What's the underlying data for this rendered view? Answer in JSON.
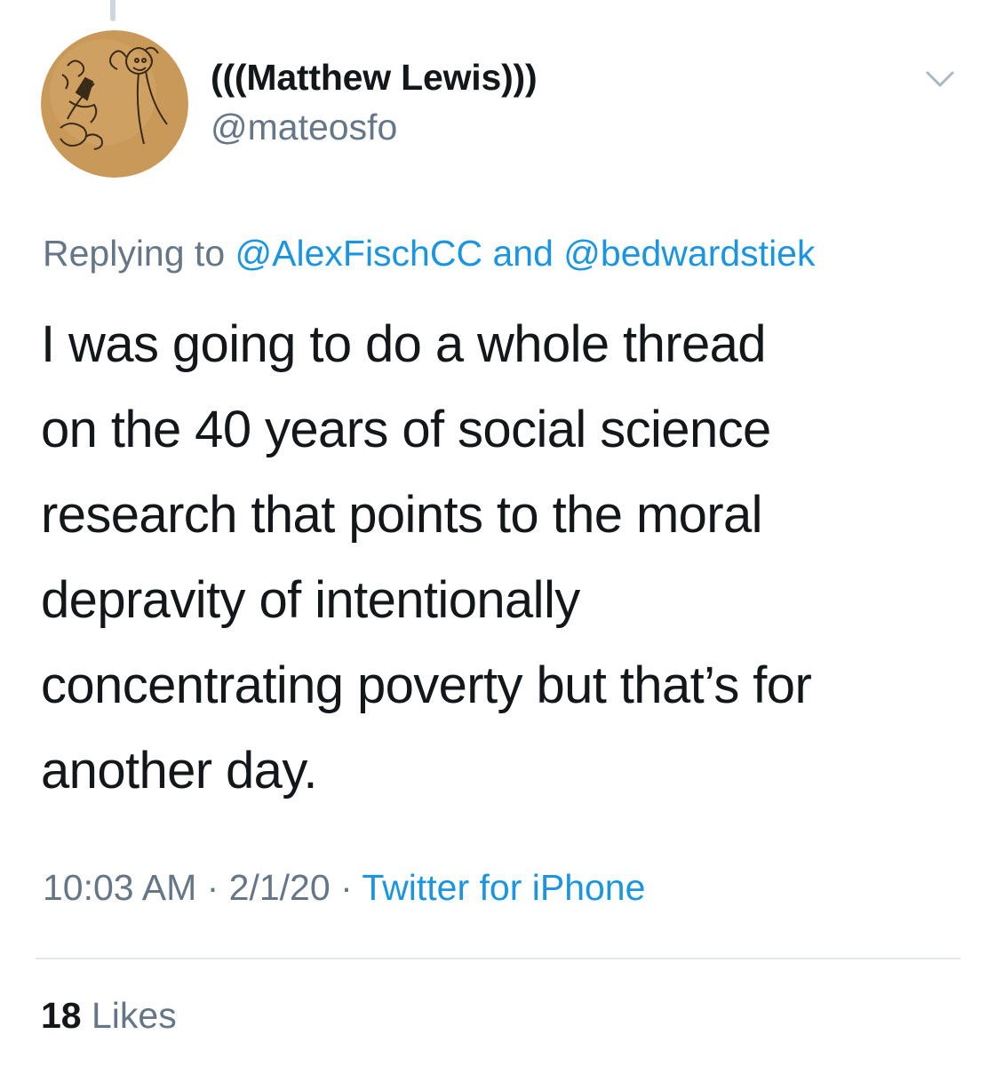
{
  "tweet": {
    "author": {
      "display_name": "(((Matthew Lewis)))",
      "handle": "@mateosfo"
    },
    "reply_context": {
      "prefix": "Replying to ",
      "mentions": [
        "@AlexFischCC",
        "@bedwardstiek"
      ],
      "joiner": " and "
    },
    "text_lines": [
      "I was going to do a whole thread",
      "on the 40 years of social science",
      "research that points to the moral",
      "depravity of intentionally",
      "concentrating poverty but that’s for",
      "another day."
    ],
    "meta": {
      "time": "10:03 AM",
      "separator": " · ",
      "date": "2/1/20",
      "source": "Twitter for iPhone"
    },
    "likes": {
      "count": "18",
      "label": " Likes"
    }
  },
  "icons": {
    "menu": "chevron-down-icon",
    "avatar": "hand-drawn-sketch-avatar"
  },
  "colors": {
    "link": "#1b95e0",
    "secondary_text": "#657786",
    "primary_text": "#14171a",
    "divider": "#e1e8ed",
    "thread_line": "#ccd6dd",
    "avatar_bg": "#c9995a"
  }
}
